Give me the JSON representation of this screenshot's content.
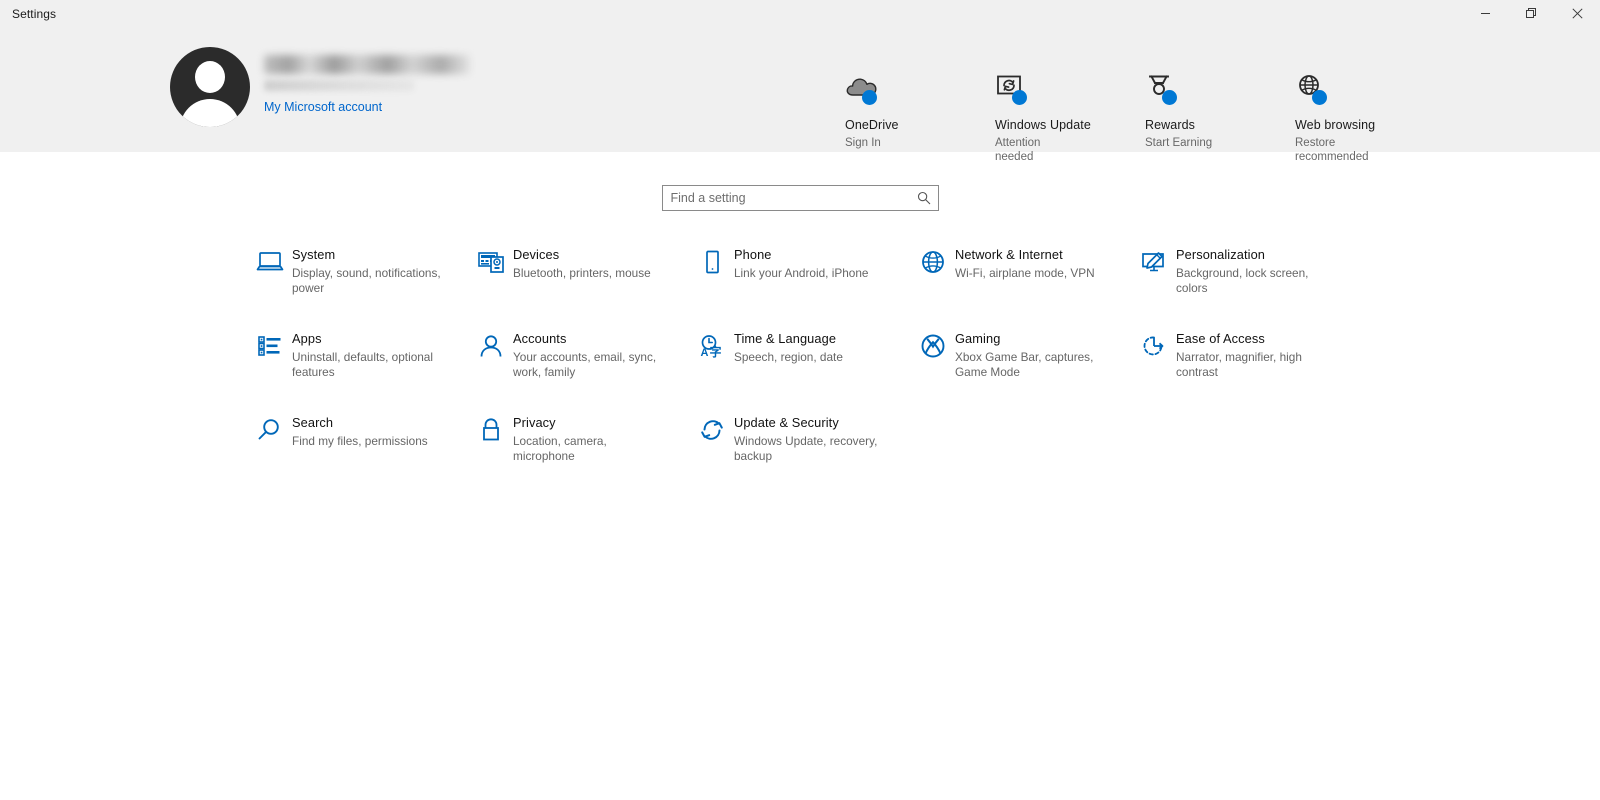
{
  "window": {
    "title": "Settings",
    "controls": [
      {
        "name": "minimize",
        "label": "—"
      },
      {
        "name": "restore",
        "label": "❐"
      },
      {
        "name": "close",
        "label": "✕"
      }
    ]
  },
  "account": {
    "display_name_redacted": "",
    "email_redacted": "",
    "link_label": "My Microsoft account",
    "avatar_icon": "person-avatar-icon"
  },
  "header_tiles": [
    {
      "icon": "onedrive-cloud-icon",
      "title": "OneDrive",
      "status": "Sign In",
      "badge": true
    },
    {
      "icon": "windows-update-icon",
      "title": "Windows Update",
      "status": "Attention needed",
      "badge": true
    },
    {
      "icon": "rewards-medal-icon",
      "title": "Rewards",
      "status": "Start Earning",
      "badge": true
    },
    {
      "icon": "web-browsing-globe-icon",
      "title": "Web browsing",
      "status": "Restore recommended",
      "badge": true
    }
  ],
  "search": {
    "placeholder": "Find a setting",
    "value": "",
    "icon": "search-magnifier-icon"
  },
  "settings": [
    {
      "icon": "system-laptop-icon",
      "title": "System",
      "subtitle": "Display, sound, notifications, power"
    },
    {
      "icon": "devices-keyboard-icon",
      "title": "Devices",
      "subtitle": "Bluetooth, printers, mouse"
    },
    {
      "icon": "phone-icon",
      "title": "Phone",
      "subtitle": "Link your Android, iPhone"
    },
    {
      "icon": "network-globe-icon",
      "title": "Network & Internet",
      "subtitle": "Wi-Fi, airplane mode, VPN"
    },
    {
      "icon": "personalization-brush-icon",
      "title": "Personalization",
      "subtitle": "Background, lock screen, colors"
    },
    {
      "icon": "apps-list-icon",
      "title": "Apps",
      "subtitle": "Uninstall, defaults, optional features"
    },
    {
      "icon": "accounts-person-icon",
      "title": "Accounts",
      "subtitle": "Your accounts, email, sync, work, family"
    },
    {
      "icon": "time-language-icon",
      "title": "Time & Language",
      "subtitle": "Speech, region, date"
    },
    {
      "icon": "gaming-xbox-icon",
      "title": "Gaming",
      "subtitle": "Xbox Game Bar, captures, Game Mode"
    },
    {
      "icon": "ease-of-access-icon",
      "title": "Ease of Access",
      "subtitle": "Narrator, magnifier, high contrast"
    },
    {
      "icon": "search-magnifier-icon",
      "title": "Search",
      "subtitle": "Find my files, permissions"
    },
    {
      "icon": "privacy-lock-icon",
      "title": "Privacy",
      "subtitle": "Location, camera, microphone"
    },
    {
      "icon": "update-security-icon",
      "title": "Update & Security",
      "subtitle": "Windows Update, recovery, backup"
    }
  ],
  "colors": {
    "accent": "#0067b8",
    "badge": "#0078d4",
    "link": "#0066cc",
    "header_band": "#f0f0f0",
    "title_text": "#121212",
    "subtitle_text": "#666666"
  }
}
